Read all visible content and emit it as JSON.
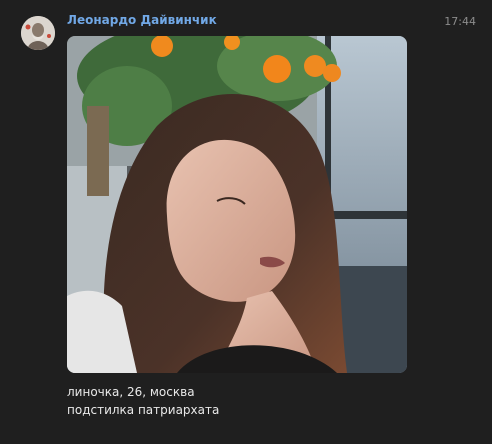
{
  "message": {
    "sender_name": "Леонардо Дайвинчик",
    "time": "17:44",
    "caption_lines": [
      "линочка, 26, москва",
      "подстилка патриархата"
    ]
  },
  "icons": {
    "avatar": "sender-avatar-image",
    "photo": "attached-photo"
  },
  "colors": {
    "background": "#1f1f1f",
    "sender_name": "#71a8e6",
    "time": "#8c8c8c",
    "caption": "#e9e9e9"
  }
}
